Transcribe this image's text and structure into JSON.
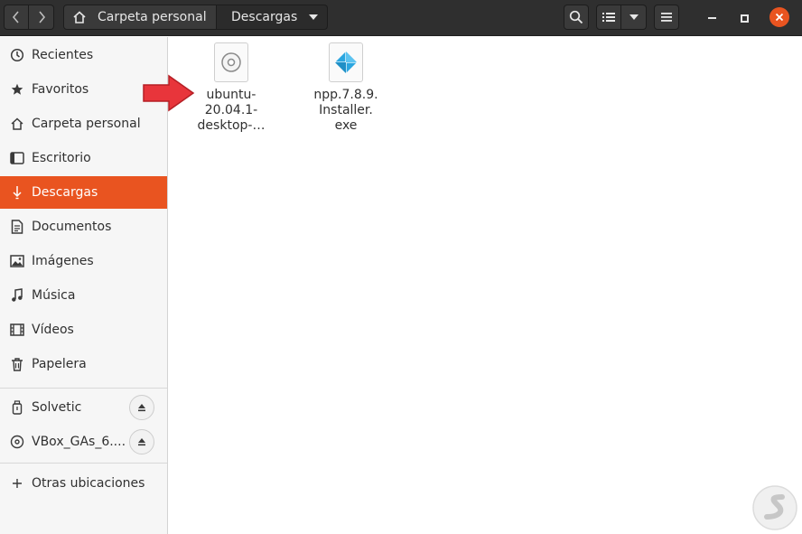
{
  "header": {
    "breadcrumbs": [
      "Carpeta personal",
      "Descargas"
    ]
  },
  "sidebar": {
    "places": [
      {
        "label": "Recientes",
        "icon": "clock-icon"
      },
      {
        "label": "Favoritos",
        "icon": "star-icon"
      },
      {
        "label": "Carpeta personal",
        "icon": "home-icon"
      },
      {
        "label": "Escritorio",
        "icon": "desktop-icon"
      },
      {
        "label": "Descargas",
        "icon": "download-icon",
        "active": true
      },
      {
        "label": "Documentos",
        "icon": "document-icon"
      },
      {
        "label": "Imágenes",
        "icon": "image-icon"
      },
      {
        "label": "Música",
        "icon": "music-icon"
      },
      {
        "label": "Vídeos",
        "icon": "video-icon"
      },
      {
        "label": "Papelera",
        "icon": "trash-icon"
      }
    ],
    "devices": [
      {
        "label": "Solvetic",
        "icon": "usb-drive-icon",
        "eject": true
      },
      {
        "label": "VBox_GAs_6....",
        "icon": "optical-disc-icon",
        "eject": true
      }
    ],
    "other": {
      "label": "Otras ubicaciones",
      "icon": "plus-icon"
    }
  },
  "files": [
    {
      "name": "ubuntu-20.04.1-desktop-…",
      "lines": [
        "ubuntu-",
        "20.04.1-",
        "desktop-…"
      ],
      "icon": "disc-image-icon"
    },
    {
      "name": "npp.7.8.9.Installer.exe",
      "lines": [
        "npp.7.8.9.",
        "Installer.",
        "exe"
      ],
      "icon": "installer-icon"
    }
  ],
  "colors": {
    "accent": "#e95420",
    "headerbar": "#2f2f2f",
    "annotation_arrow": "#e8353b"
  }
}
